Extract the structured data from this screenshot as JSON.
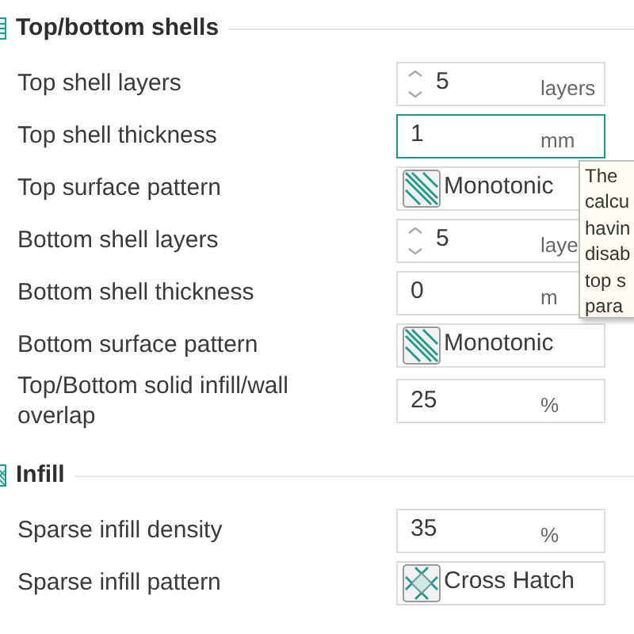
{
  "sections": [
    {
      "title": "Top/bottom shells",
      "rows": [
        {
          "label": "Top shell layers",
          "kind": "spin",
          "value": "5",
          "unit": "layers",
          "focused": false
        },
        {
          "label": "Top shell thickness",
          "kind": "text",
          "value": "1",
          "unit": "mm",
          "focused": true
        },
        {
          "label": "Top surface pattern",
          "kind": "stripes",
          "value": "Monotonic"
        },
        {
          "label": "Bottom shell layers",
          "kind": "spin",
          "value": "5",
          "unit": "laye",
          "focused": false
        },
        {
          "label": "Bottom shell thickness",
          "kind": "text",
          "value": "0",
          "unit": "m",
          "focused": false
        },
        {
          "label": "Bottom surface pattern",
          "kind": "stripes",
          "value": "Monotonic"
        },
        {
          "label": "Top/Bottom solid infill/wall overlap",
          "kind": "text",
          "value": "25",
          "unit": "%",
          "focused": false
        }
      ]
    },
    {
      "title": "Infill",
      "rows": [
        {
          "label": "Sparse infill density",
          "kind": "text",
          "value": "35",
          "unit": "%",
          "focused": false
        },
        {
          "label": "Sparse infill pattern",
          "kind": "crosshatch",
          "value": "Cross Hatch"
        }
      ]
    }
  ],
  "tooltip": {
    "lines": [
      "The",
      "calcu",
      "havin",
      "disab",
      "top s",
      "para"
    ]
  }
}
